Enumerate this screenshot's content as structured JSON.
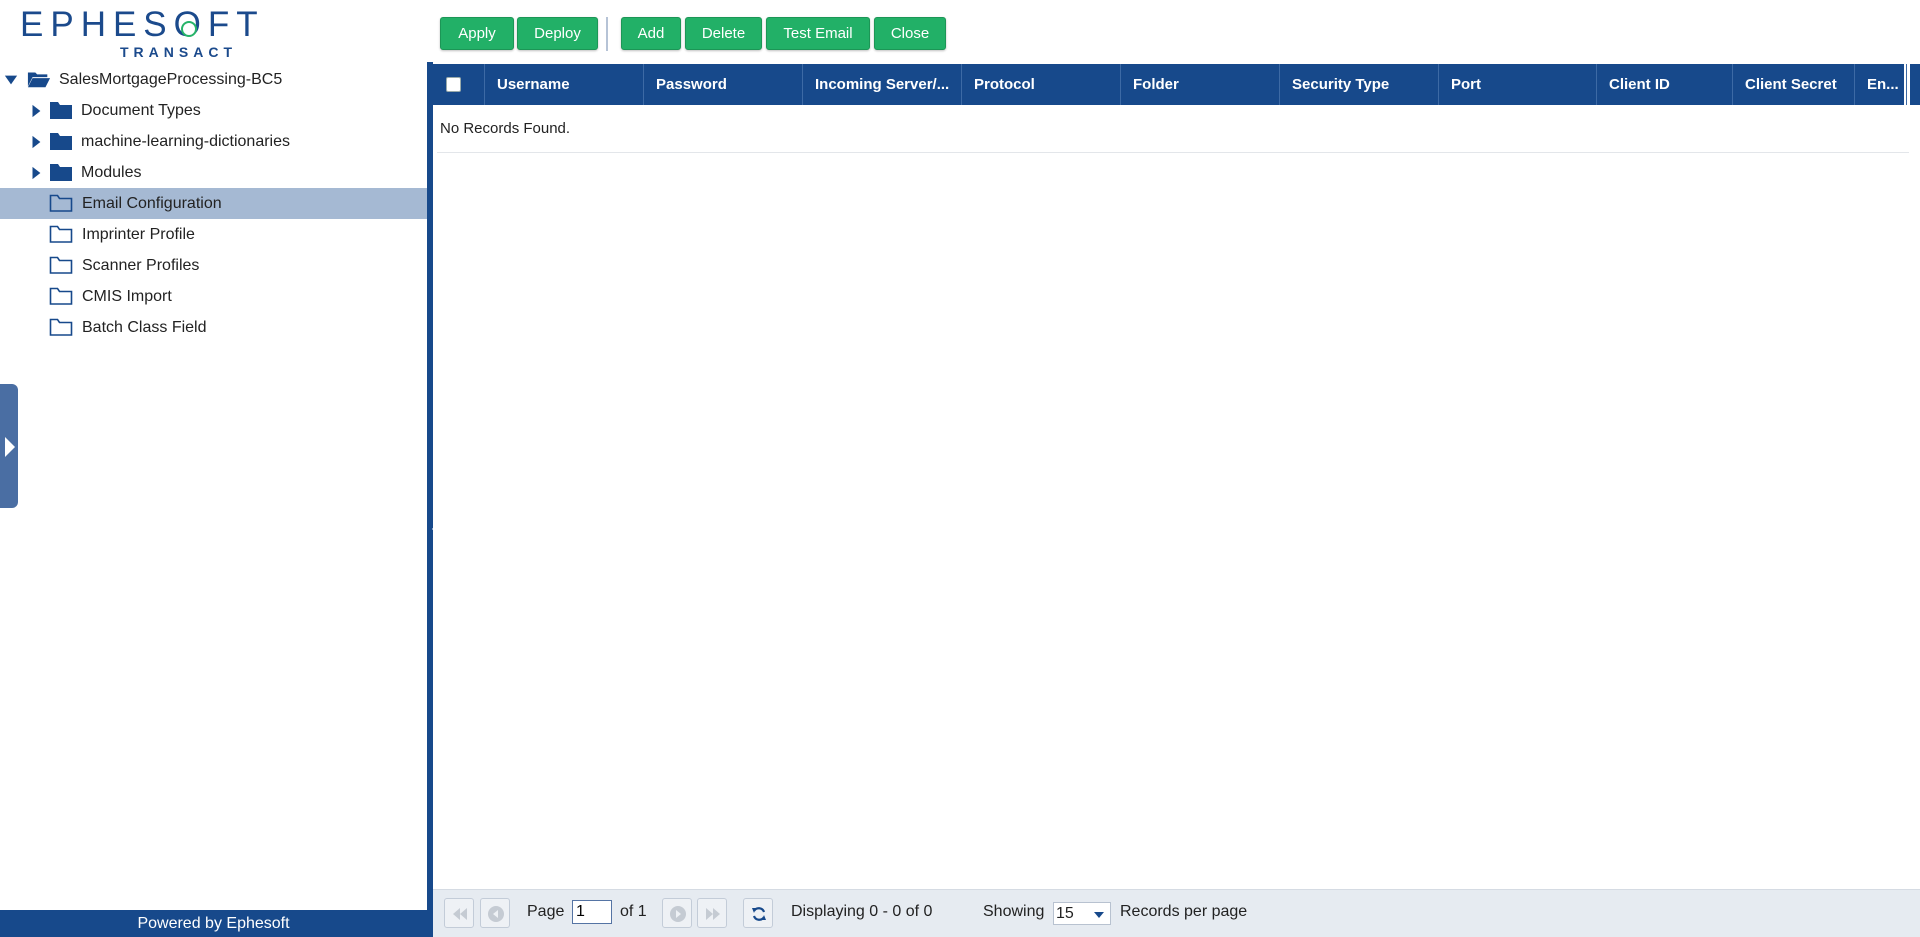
{
  "brand": {
    "name": "EPHESOFT",
    "product": "TRANSACT",
    "footer": "Powered by Ephesoft"
  },
  "toolbar": {
    "apply": "Apply",
    "deploy": "Deploy",
    "add": "Add",
    "delete": "Delete",
    "test_email": "Test Email",
    "close": "Close"
  },
  "tree": {
    "root": "SalesMortgageProcessing-BC5",
    "items": [
      {
        "label": "Document Types",
        "expandable": true,
        "icon": "folder-filled-icon"
      },
      {
        "label": "machine-learning-dictionaries",
        "expandable": true,
        "icon": "folder-filled-icon"
      },
      {
        "label": "Modules",
        "expandable": true,
        "icon": "folder-filled-icon"
      },
      {
        "label": "Email Configuration",
        "expandable": false,
        "icon": "folder-outline-icon",
        "selected": true
      },
      {
        "label": "Imprinter Profile",
        "expandable": false,
        "icon": "folder-outline-icon"
      },
      {
        "label": "Scanner Profiles",
        "expandable": false,
        "icon": "folder-outline-icon"
      },
      {
        "label": "CMIS Import",
        "expandable": false,
        "icon": "folder-outline-icon"
      },
      {
        "label": "Batch Class Field",
        "expandable": false,
        "icon": "folder-outline-icon"
      }
    ]
  },
  "grid": {
    "columns": [
      "Username",
      "Password",
      "Incoming Server/...",
      "Protocol",
      "Folder",
      "Security Type",
      "Port",
      "Client ID",
      "Client Secret",
      "En..."
    ],
    "empty_text": "No Records Found."
  },
  "pager": {
    "page_label": "Page",
    "page_value": "1",
    "of_label": "of 1",
    "displaying": "Displaying 0 - 0 of 0",
    "showing": "Showing",
    "per_page_value": "15",
    "per_page_label": "Records per page"
  },
  "colors": {
    "primary": "#17498b",
    "accent": "#22b067",
    "selected": "#a5b9d3"
  }
}
